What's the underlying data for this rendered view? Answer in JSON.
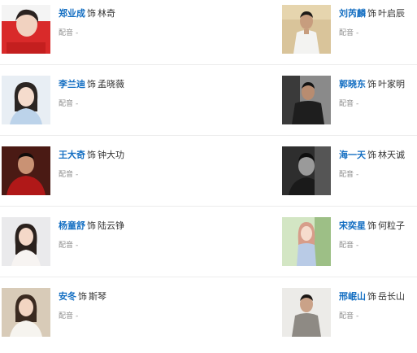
{
  "cast": [
    {
      "actor": "郑业成",
      "sep": "饰",
      "role": "林奇",
      "dub_label": "配音",
      "dub_value": "-"
    },
    {
      "actor": "刘芮麟",
      "sep": "饰",
      "role": "叶启辰",
      "dub_label": "配音",
      "dub_value": "-"
    },
    {
      "actor": "李兰迪",
      "sep": "饰",
      "role": "孟晓薇",
      "dub_label": "配音",
      "dub_value": "-"
    },
    {
      "actor": "郭晓东",
      "sep": "饰",
      "role": "叶家明",
      "dub_label": "配音",
      "dub_value": "-"
    },
    {
      "actor": "王大奇",
      "sep": "饰",
      "role": "钟大功",
      "dub_label": "配音",
      "dub_value": "-"
    },
    {
      "actor": "海一天",
      "sep": "饰",
      "role": "林天诚",
      "dub_label": "配音",
      "dub_value": "-"
    },
    {
      "actor": "杨童舒",
      "sep": "饰",
      "role": "陆云铮",
      "dub_label": "配音",
      "dub_value": "-"
    },
    {
      "actor": "宋奕星",
      "sep": "饰",
      "role": "何粒子",
      "dub_label": "配音",
      "dub_value": "-"
    },
    {
      "actor": "安冬",
      "sep": "饰",
      "role": "斯琴",
      "dub_label": "配音",
      "dub_value": "-"
    },
    {
      "actor": "邢岷山",
      "sep": "饰",
      "role": "岳长山",
      "dub_label": "配音",
      "dub_value": "-"
    }
  ],
  "colors": {
    "actor_link": "#136ec2",
    "text": "#333333",
    "muted": "#8c8c8c",
    "divider": "#ececec"
  }
}
